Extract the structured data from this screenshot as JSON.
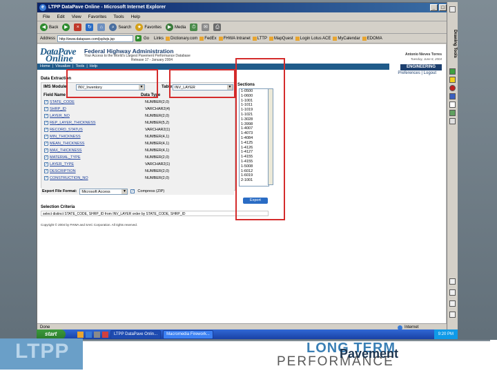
{
  "window": {
    "title": "LTPP DataPave Online - Microsoft Internet Explorer",
    "controls": [
      "_",
      "□",
      "×"
    ]
  },
  "menu": [
    "File",
    "Edit",
    "View",
    "Favorites",
    "Tools",
    "Help"
  ],
  "toolbar": {
    "back": "Back",
    "search": "Search",
    "favorites": "Favorites",
    "media": "Media"
  },
  "address": {
    "label": "Address",
    "url": "http://www.datapave.com/jsp/wjs.jsp",
    "go": "Go",
    "links_label": "Links",
    "links": [
      "Dictionary.com",
      "FedEx",
      "FHWA Intranet",
      "LTTP",
      "MapQuest",
      "Login Lotus ACE",
      "MyCalendar",
      "EDOMA"
    ]
  },
  "header": {
    "logo_line1": "DataPave",
    "logo_line2": "Online",
    "org": "Federal Highway Administration",
    "tagline": "Your Access to the World's Largest Pavement Performance Database",
    "release": "Release 17 - January 2004",
    "user": "Antonio Nieves Torres",
    "date": "Tuesday, June 8, 2004",
    "badge": "ENGINEERING",
    "pref": "Preferences | Logout"
  },
  "nav": [
    "Home",
    "|",
    "Visualize",
    "|",
    "Tools",
    "|",
    "Help"
  ],
  "extraction": {
    "title": "Data Extraction",
    "ims_label": "IMS Module:",
    "ims_value": "INV_Inventory",
    "table_label": "Table:",
    "table_value": "INV_LAYER",
    "col_field": "Field Name",
    "col_type": "Data Type",
    "fields": [
      {
        "name": "STATE_CODE",
        "type": "NUMBER(2,0)"
      },
      {
        "name": "SHRP_ID",
        "type": "VARCHAR2(4)"
      },
      {
        "name": "LAYER_NO",
        "type": "NUMBER(2,0)"
      },
      {
        "name": "REP_LAYER_THICKNESS",
        "type": "NUMBER(5,2)"
      },
      {
        "name": "RECORD_STATUS",
        "type": "VARCHAR2(1)"
      },
      {
        "name": "MIN_THICKNESS",
        "type": "NUMBER(4,1)"
      },
      {
        "name": "MEAN_THICKNESS",
        "type": "NUMBER(4,1)"
      },
      {
        "name": "MAX_THICKNESS",
        "type": "NUMBER(4,1)"
      },
      {
        "name": "MATERIAL_TYPE",
        "type": "NUMBER(2,0)"
      },
      {
        "name": "LAYER_TYPE",
        "type": "VARCHAR2(1)"
      },
      {
        "name": "DESCRIPTION",
        "type": "NUMBER(2,0)"
      },
      {
        "name": "CONSTRUCTION_NO",
        "type": "NUMBER(2,0)"
      }
    ],
    "sections_label": "Sections",
    "sections": [
      "1-0500",
      "1-0600",
      "1-1001",
      "1-1011",
      "1-1019",
      "1-1021",
      "1-3028",
      "1-3998",
      "1-4007",
      "1-4073",
      "1-4084",
      "1-4125",
      "1-4126",
      "1-4127",
      "1-4155",
      "1-4155",
      "1-5008",
      "1-6012",
      "1-6019",
      "2-1001"
    ],
    "export_label": "Export File Format:",
    "export_value": "Microsoft Access",
    "compress_label": "Compress (ZIP)",
    "export_btn": "Export"
  },
  "criteria": {
    "title": "Selection Criteria",
    "query": "select distinct STATE_CODE, SHRP_ID from INV_LAYER order by STATE_CODE, SHRP_ID"
  },
  "copyright": "Copyright © 2004 by FHWA and SAIC Corporation. All rights reserved.",
  "statusbar": {
    "left": "Done",
    "right": "Internet"
  },
  "taskbar": {
    "start": "start",
    "items": [
      "LTPP DataPave Onlin...",
      "Macromedia Firework..."
    ],
    "clock": "9:20 PM"
  },
  "sidebar": {
    "title": "Drawing Tools"
  },
  "slide": {
    "ltpp": "LTPP",
    "long_term": "LONG TERM",
    "pavement": "Pavement",
    "performance": "PERFORMANCE"
  }
}
